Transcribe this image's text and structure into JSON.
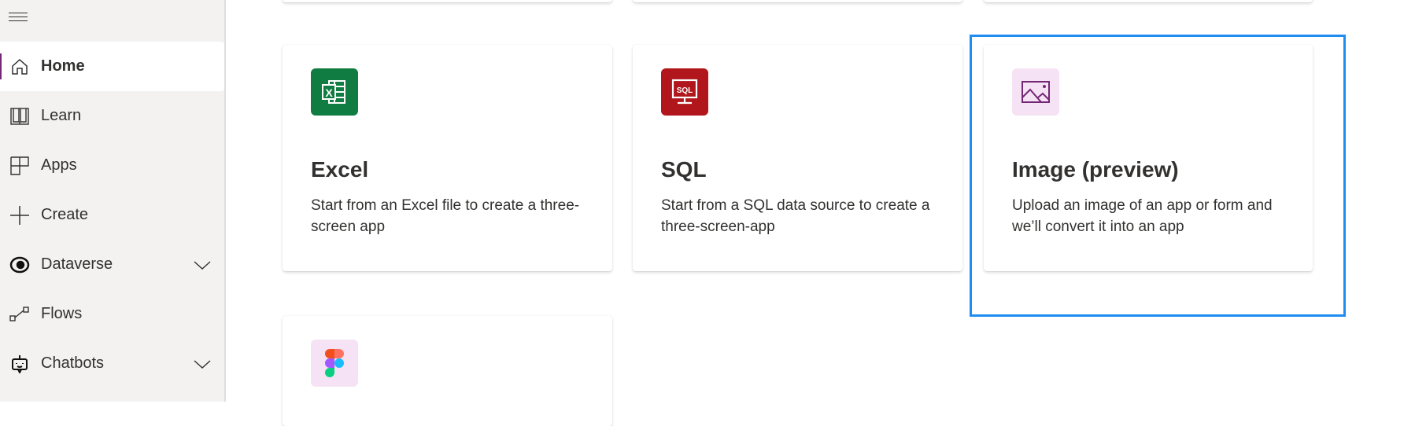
{
  "sidebar": {
    "items": [
      {
        "label": "Home",
        "icon": "home-icon"
      },
      {
        "label": "Learn",
        "icon": "book-icon"
      },
      {
        "label": "Apps",
        "icon": "apps-icon"
      },
      {
        "label": "Create",
        "icon": "plus-icon"
      },
      {
        "label": "Dataverse",
        "icon": "dataverse-icon",
        "expandable": true
      },
      {
        "label": "Flows",
        "icon": "flows-icon"
      },
      {
        "label": "Chatbots",
        "icon": "chatbot-icon",
        "expandable": true
      }
    ]
  },
  "cards": [
    {
      "title": "Excel",
      "description": "Start from an Excel file to create a three-screen app",
      "icon": "excel-icon",
      "color": "#107c41"
    },
    {
      "title": "SQL",
      "description": "Start from a SQL data source to create a three-screen-app",
      "icon": "sql-icon",
      "color": "#b0161b",
      "icon_text": "SQL"
    },
    {
      "title": "Image (preview)",
      "description": "Upload an image of an app or form and we’ll convert it into an app",
      "icon": "image-icon",
      "color": "#f5e3f5"
    },
    {
      "icon": "figma-icon",
      "color": "#f5e3f5"
    }
  ],
  "colors": {
    "accent": "#742774",
    "focus": "#1e8cf0"
  }
}
